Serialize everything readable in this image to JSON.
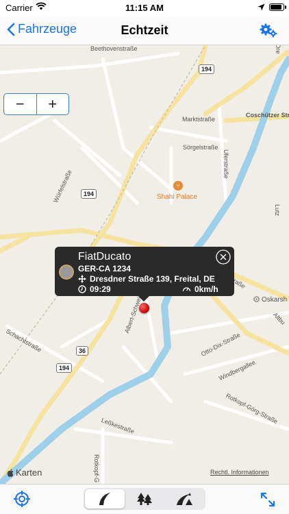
{
  "status_bar": {
    "carrier": "Carrier",
    "time": "11:15 AM",
    "icons": [
      "wifi-icon",
      "location-arrow-icon",
      "battery-icon"
    ]
  },
  "nav": {
    "back_label": "Fahrzeuge",
    "title": "Echtzeit",
    "settings_icon": "gears-icon"
  },
  "map": {
    "zoom_out_label": "−",
    "zoom_in_label": "+",
    "road_labels": [
      "Beethovenstraße",
      "Marktstraße",
      "Sörgelstraße",
      "Coschützer Str",
      "Uferstraße",
      "Würfelstraße",
      "Burgker Straße",
      "Albert-Schweitzer-Straße",
      "Schachtstraße",
      "Otto-Dix-Straße",
      "Windbergallee",
      "Rotkopf-Görg-Straße",
      "Leßkestraße",
      "Rotkopf-G",
      "Altbu",
      "Lutz",
      "Dre"
    ],
    "route_shields": [
      "194",
      "194",
      "36",
      "36",
      "194"
    ],
    "poi_name": "Shahi Palace",
    "poi_icon": "fork-knife-icon",
    "place_label": "Oskarsh",
    "logo_text": "Karten",
    "legal_link": "Rechtl. Informationen",
    "colors": {
      "water": "#9fd0ea",
      "road_major": "#f7e3a0",
      "road_minor": "#ffffff",
      "background": "#f1eee7"
    }
  },
  "popup": {
    "vehicle_name": "FiatDucato",
    "plate": "GER-CA 1234",
    "address": "Dresdner Straße 139, Freital, DE",
    "time": "09:29",
    "speed": "0km/h"
  },
  "toolbar": {
    "segments": [
      {
        "icon": "road-icon",
        "active": true
      },
      {
        "icon": "trees-icon",
        "active": false
      },
      {
        "icon": "terrain-road-icon",
        "active": false
      }
    ],
    "accent": "#1a73e8"
  }
}
